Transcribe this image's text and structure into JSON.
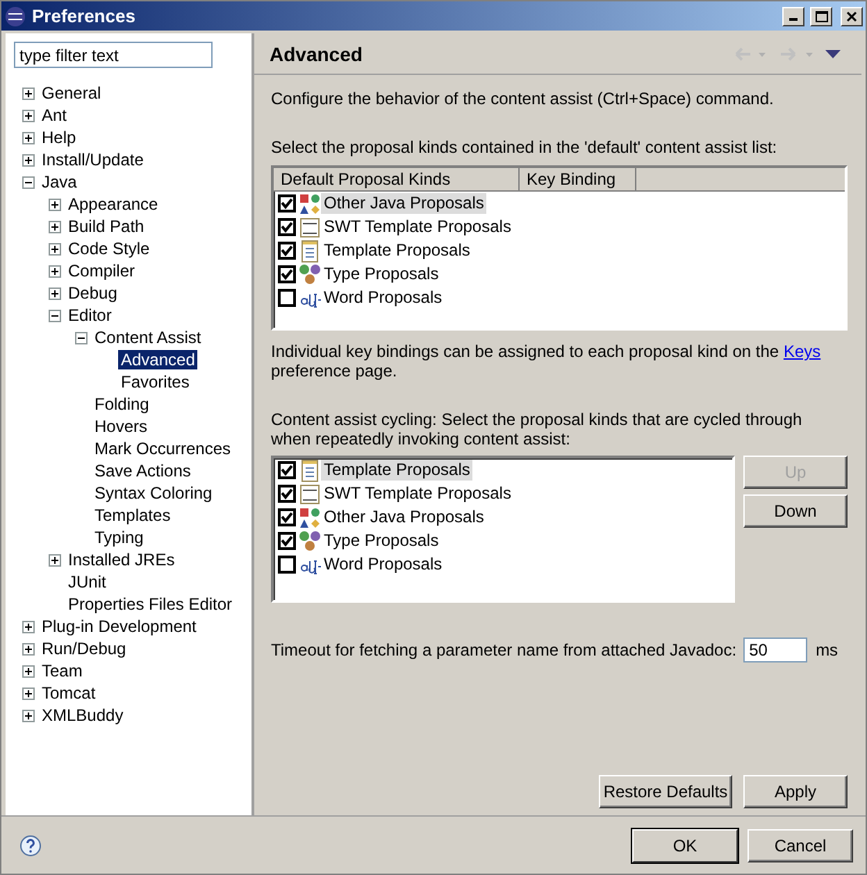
{
  "window": {
    "title": "Preferences"
  },
  "filter": {
    "placeholder": "type filter text"
  },
  "tree": [
    {
      "label": "General",
      "expanded": false,
      "selected": false
    },
    {
      "label": "Ant",
      "expanded": false,
      "selected": false
    },
    {
      "label": "Help",
      "expanded": false,
      "selected": false
    },
    {
      "label": "Install/Update",
      "expanded": false,
      "selected": false
    },
    {
      "label": "Java",
      "expanded": true,
      "selected": false,
      "children": [
        {
          "label": "Appearance",
          "expanded": false,
          "selected": false
        },
        {
          "label": "Build Path",
          "expanded": false,
          "selected": false
        },
        {
          "label": "Code Style",
          "expanded": false,
          "selected": false
        },
        {
          "label": "Compiler",
          "expanded": false,
          "selected": false
        },
        {
          "label": "Debug",
          "expanded": false,
          "selected": false
        },
        {
          "label": "Editor",
          "expanded": true,
          "selected": false,
          "children": [
            {
              "label": "Content Assist",
              "expanded": true,
              "selected": false,
              "children": [
                {
                  "label": "Advanced",
                  "selected": true
                },
                {
                  "label": "Favorites",
                  "selected": false
                }
              ]
            },
            {
              "label": "Folding",
              "selected": false
            },
            {
              "label": "Hovers",
              "selected": false
            },
            {
              "label": "Mark Occurrences",
              "selected": false
            },
            {
              "label": "Save Actions",
              "selected": false
            },
            {
              "label": "Syntax Coloring",
              "selected": false
            },
            {
              "label": "Templates",
              "selected": false
            },
            {
              "label": "Typing",
              "selected": false
            }
          ]
        },
        {
          "label": "Installed JREs",
          "expanded": false,
          "selected": false
        },
        {
          "label": "JUnit",
          "selected": false
        },
        {
          "label": "Properties Files Editor",
          "selected": false
        }
      ]
    },
    {
      "label": "Plug-in Development",
      "expanded": false,
      "selected": false
    },
    {
      "label": "Run/Debug",
      "expanded": false,
      "selected": false
    },
    {
      "label": "Team",
      "expanded": false,
      "selected": false
    },
    {
      "label": "Tomcat",
      "expanded": false,
      "selected": false
    },
    {
      "label": "XMLBuddy",
      "expanded": false,
      "selected": false
    }
  ],
  "page": {
    "title": "Advanced",
    "intro": "Configure the behavior of the content assist (Ctrl+Space) command.",
    "default_list": {
      "caption": "Select the proposal kinds contained in the 'default' content assist list:",
      "columns": [
        "Default Proposal Kinds",
        "Key Binding"
      ],
      "rows": [
        {
          "label": "Other Java Proposals",
          "kind": "java",
          "checked": true,
          "selected": true
        },
        {
          "label": "SWT Template Proposals",
          "kind": "swt",
          "checked": true,
          "selected": false
        },
        {
          "label": "Template Proposals",
          "kind": "template",
          "checked": true,
          "selected": false
        },
        {
          "label": "Type Proposals",
          "kind": "type",
          "checked": true,
          "selected": false
        },
        {
          "label": "Word Proposals",
          "kind": "word",
          "checked": false,
          "selected": false
        }
      ]
    },
    "keys_note": {
      "before": "Individual key bindings can be assigned to each proposal kind on the",
      "link": "Keys",
      "after": "preference page."
    },
    "cycling_list": {
      "caption": "Content assist cycling: Select the proposal kinds that are cycled through when repeatedly invoking content assist:",
      "rows": [
        {
          "label": "Template Proposals",
          "kind": "template",
          "checked": true,
          "selected": true
        },
        {
          "label": "SWT Template Proposals",
          "kind": "swt",
          "checked": true,
          "selected": false
        },
        {
          "label": "Other Java Proposals",
          "kind": "java",
          "checked": true,
          "selected": false
        },
        {
          "label": "Type Proposals",
          "kind": "type",
          "checked": true,
          "selected": false
        },
        {
          "label": "Word Proposals",
          "kind": "word",
          "checked": false,
          "selected": false
        }
      ],
      "buttons": [
        {
          "label": "Up",
          "disabled": true
        },
        {
          "label": "Down",
          "disabled": false
        }
      ]
    },
    "timeout": {
      "label": "Timeout for fetching a parameter name from attached Javadoc:",
      "value": "50",
      "unit": "ms"
    },
    "buttons": [
      "Restore Defaults",
      "Apply"
    ]
  },
  "footer": {
    "buttons": [
      {
        "label": "OK",
        "default": true
      },
      {
        "label": "Cancel",
        "default": false
      }
    ]
  }
}
